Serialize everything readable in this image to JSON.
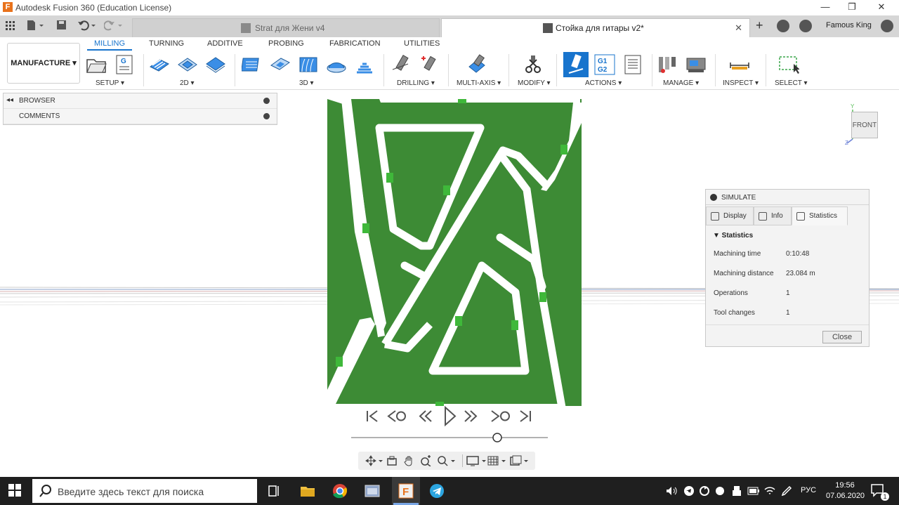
{
  "window": {
    "app_icon": "F",
    "title": "Autodesk Fusion 360 (Education License)",
    "minimize": "—",
    "maximize": "❐",
    "close": "✕"
  },
  "tabs": [
    {
      "label": "Strat для Жени v4",
      "active": false
    },
    {
      "label": "Стойка для гитары v2*",
      "active": true
    }
  ],
  "user": "Famous King",
  "workspace": "MANUFACTURE ▾",
  "category_tabs": [
    "MILLING",
    "TURNING",
    "ADDITIVE",
    "PROBING",
    "FABRICATION",
    "UTILITIES"
  ],
  "groups": [
    "SETUP ▾",
    "2D ▾",
    "3D ▾",
    "DRILLING ▾",
    "MULTI-AXIS ▾",
    "MODIFY ▾",
    "ACTIONS ▾",
    "MANAGE ▾",
    "INSPECT ▾",
    "SELECT ▾"
  ],
  "browser": [
    {
      "label": "BROWSER",
      "toggle": "◂◂"
    },
    {
      "label": "COMMENTS",
      "toggle": ""
    }
  ],
  "viewcube": {
    "face": "FRONT",
    "axis_y": "Y",
    "axis_z": "Z"
  },
  "simulate": {
    "title": "SIMULATE",
    "tabs": [
      "Display",
      "Info",
      "Statistics"
    ],
    "section": "▼ Statistics",
    "stats": [
      {
        "key": "Machining time",
        "value": "0:10:48"
      },
      {
        "key": "Machining distance",
        "value": "23.084 m"
      },
      {
        "key": "Operations",
        "value": "1"
      },
      {
        "key": "Tool changes",
        "value": "1"
      }
    ],
    "close": "Close"
  },
  "taskbar": {
    "search_placeholder": "Введите здесь текст для поиска",
    "lang": "РУС",
    "time": "19:56",
    "date": "07.06.2020",
    "notif_count": "1"
  },
  "colors": {
    "part_green": "#3d8b35",
    "accent_blue": "#1874cd",
    "taskbar": "#1f1f1f"
  }
}
